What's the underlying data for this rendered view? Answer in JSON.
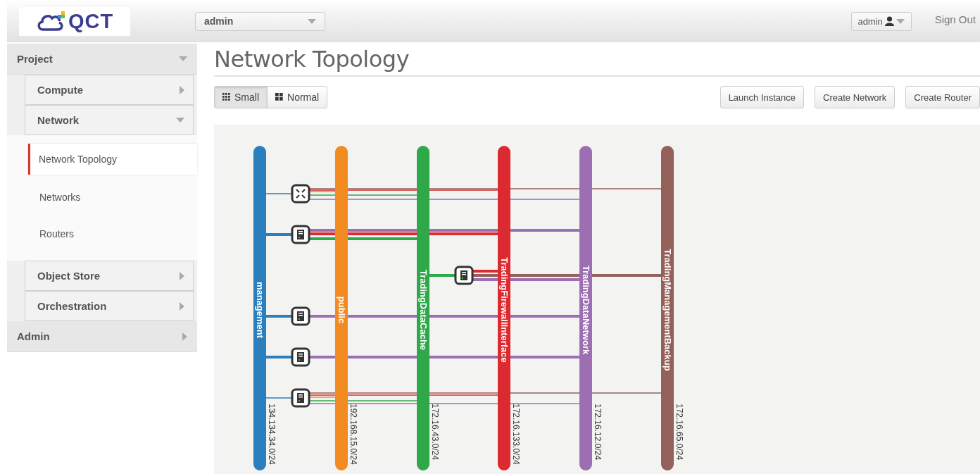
{
  "header": {
    "logo_text": "QCT",
    "project_select": {
      "value": "admin"
    },
    "user_menu": {
      "label": "admin"
    },
    "sign_out": "Sign Out"
  },
  "sidebar": {
    "items": [
      {
        "label": "Project",
        "expanded": true,
        "children": [
          {
            "label": "Compute",
            "expanded": false
          },
          {
            "label": "Network",
            "expanded": true,
            "children": [
              {
                "label": "Network Topology",
                "selected": true
              },
              {
                "label": "Networks",
                "selected": false
              },
              {
                "label": "Routers",
                "selected": false
              }
            ]
          },
          {
            "label": "Object Store",
            "expanded": false
          },
          {
            "label": "Orchestration",
            "expanded": false
          }
        ]
      },
      {
        "label": "Admin",
        "expanded": false
      }
    ]
  },
  "page": {
    "title": "Network Topology",
    "view_toggle": [
      {
        "label": "Small",
        "kind": "small",
        "selected": true
      },
      {
        "label": "Normal",
        "kind": "normal",
        "selected": false
      }
    ],
    "actions": [
      "Launch Instance",
      "Create Network",
      "Create Router"
    ]
  },
  "topology": {
    "networks": [
      {
        "name": "management",
        "cidr": "134.134.34.0/24",
        "color": "#2c7fbd"
      },
      {
        "name": "public",
        "cidr": "192.168.15.0/24",
        "color": "#f28c22"
      },
      {
        "name": "TradingDataCache",
        "cidr": "172.16.43.0/24",
        "color": "#2fa84a"
      },
      {
        "name": "TradingFirewallInterface",
        "cidr": "172.16.133.0/24",
        "color": "#dc2b30"
      },
      {
        "name": "TradingDataNetwork",
        "cidr": "172.16.12.0/24",
        "color": "#9b6fb1"
      },
      {
        "name": "TradingManagementBackup",
        "cidr": "172.16.65.0/24",
        "color": "#93605a"
      }
    ],
    "devices": [
      {
        "kind": "router"
      },
      {
        "kind": "server"
      },
      {
        "kind": "server"
      },
      {
        "kind": "server"
      },
      {
        "kind": "server"
      },
      {
        "kind": "server"
      }
    ]
  }
}
